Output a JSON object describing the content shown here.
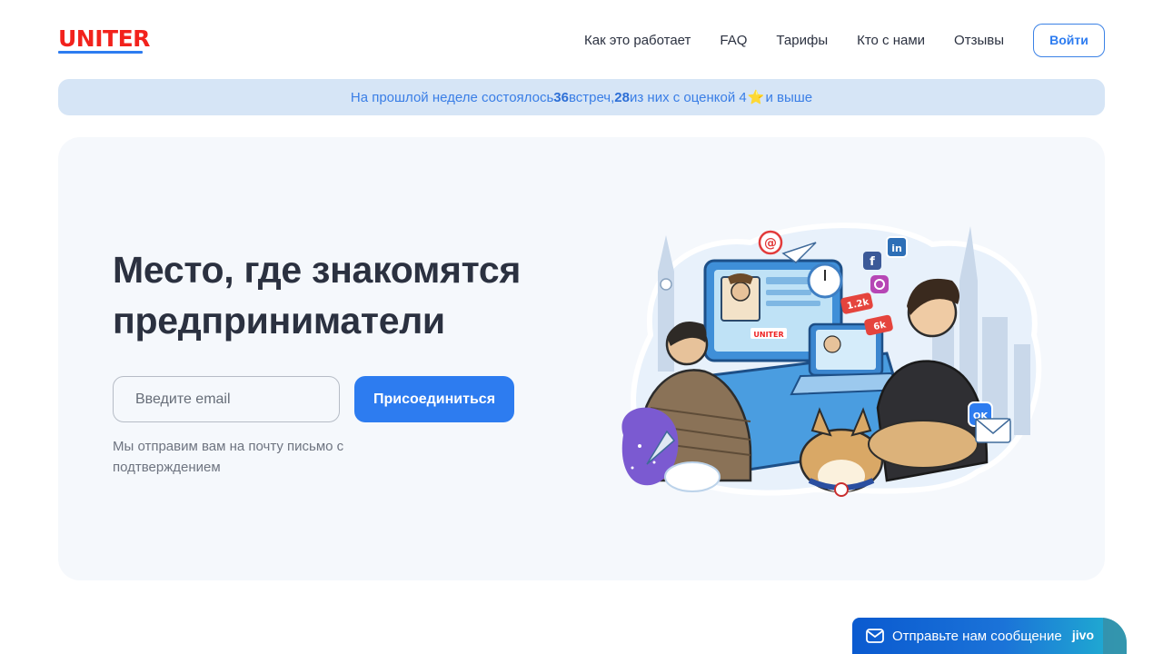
{
  "header": {
    "logo_text": "UNITER",
    "nav": [
      {
        "label": "Как это работает"
      },
      {
        "label": "FAQ"
      },
      {
        "label": "Тарифы"
      },
      {
        "label": "Кто с нами"
      },
      {
        "label": "Отзывы"
      }
    ],
    "login_label": "Войти"
  },
  "banner": {
    "part1": "На прошлой неделе состоялось ",
    "meetings": "36",
    "part2": " встреч, ",
    "rated": "28",
    "part3": " из них с оценкой 4",
    "star": "⭐",
    "part4": " и выше"
  },
  "hero": {
    "title": "Место, где знакомятся предприниматели",
    "email_placeholder": "Введите email",
    "join_label": "Присоединиться",
    "hint": "Мы отправим вам на почту письмо с подтверждением",
    "illustration_badges": {
      "at": "@",
      "uniter": "UNITER",
      "likes": "1.2k",
      "followers": "6k",
      "ok": "OK"
    }
  },
  "chat_widget": {
    "label": "Отправьте нам сообщение",
    "brand": "jivo"
  },
  "colors": {
    "brand_red": "#f2221c",
    "accent_blue": "#2d7cf0",
    "banner_bg": "#d6e5f6",
    "hero_bg": "#f5f8fc"
  }
}
